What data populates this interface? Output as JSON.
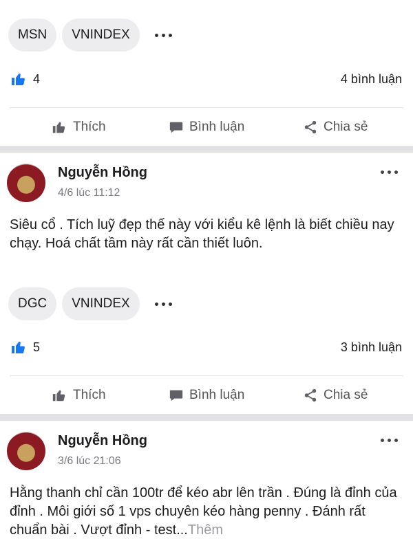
{
  "post1": {
    "tags": [
      "MSN",
      "VNINDEX"
    ],
    "likes": "4",
    "comments": "4 bình luận"
  },
  "actions": {
    "like": "Thích",
    "comment": "Bình luận",
    "share": "Chia sẻ"
  },
  "post2": {
    "author": "Nguyễn Hồng",
    "time": "4/6 lúc 11:12",
    "text": "Siêu cổ . Tích luỹ đẹp thế này với kiểu kê lệnh là biết chiều nay chạy. Hoá chất tầm này rất cần thiết luôn.",
    "tags": [
      "DGC",
      "VNINDEX"
    ],
    "likes": "5",
    "comments": "3 bình luận"
  },
  "post3": {
    "author": "Nguyễn Hồng",
    "time": "3/6 lúc 21:06",
    "text": "Hằng thanh chỉ cần 100tr để kéo abr lên trần . Đúng là đỉnh của đỉnh . Môi giới số 1 vps chuyên kéo hàng penny . Đánh rất chuẩn bài . Vượt đỉnh - test...",
    "see_more": "Thêm"
  },
  "colors": {
    "like_blue": "#1877f2",
    "band": "#e2e2e5"
  }
}
